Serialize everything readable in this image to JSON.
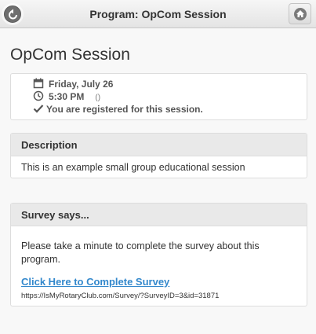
{
  "header": {
    "title": "Program: OpCom Session",
    "back_icon": "back-arrow-icon",
    "home_icon": "home-icon"
  },
  "page": {
    "title": "OpCom Session"
  },
  "info": {
    "date": "Friday, July 26",
    "time": "5:30 PM",
    "time_note": "()",
    "registered": "You are registered for this session.",
    "icons": [
      "calendar-icon",
      "clock-icon",
      "check-icon"
    ]
  },
  "description": {
    "heading": "Description",
    "text": "This is an example small group educational session"
  },
  "survey": {
    "heading": "Survey says...",
    "text": "Please take a minute to complete the survey about this program.",
    "link_label": "Click Here to Complete Survey",
    "url": "https://IsMyRotaryClub.com/Survey/?SurveyID=3&id=31871"
  },
  "colors": {
    "link": "#3388cc",
    "header_bg": "#e9e9e9",
    "card_bg": "#ffffff"
  }
}
